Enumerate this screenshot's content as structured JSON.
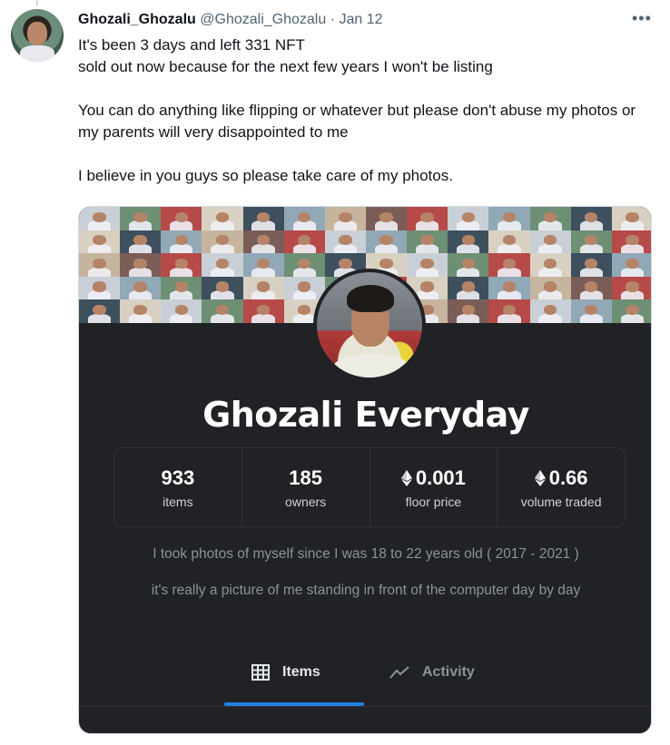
{
  "tweet": {
    "display_name": "Ghozali_Ghozalu",
    "handle": "@Ghozali_Ghozalu",
    "separator": "·",
    "date": "Jan 12",
    "more_icon": "more-horizontal-icon",
    "lines": [
      "It's been 3 days and left 331 NFT",
      "sold out now because for the next few years I won't be listing",
      "You can do anything like flipping or whatever but please don't abuse my photos or my parents will very disappointed to me",
      "I believe in you guys so please take care of my photos."
    ]
  },
  "card": {
    "collection_name": "Ghozali Everyday",
    "stats": [
      {
        "value": "933",
        "label": "items",
        "icon": ""
      },
      {
        "value": "185",
        "label": "owners",
        "icon": ""
      },
      {
        "value": "0.001",
        "label": "floor price",
        "icon": "ethereum-icon"
      },
      {
        "value": "0.66",
        "label": "volume traded",
        "icon": "ethereum-icon"
      }
    ],
    "description_1": "I took photos of myself since I was 18 to 22 years old ( 2017 - 2021 )",
    "description_2": "it's really a picture of me standing in front of the computer day by day",
    "tabs": [
      {
        "label": "Items",
        "icon": "grid-icon",
        "active": true
      },
      {
        "label": "Activity",
        "icon": "activity-chart-icon",
        "active": false
      }
    ],
    "colors": {
      "background": "#202225",
      "accent": "#2081e2",
      "text_muted": "#8a939b"
    }
  }
}
